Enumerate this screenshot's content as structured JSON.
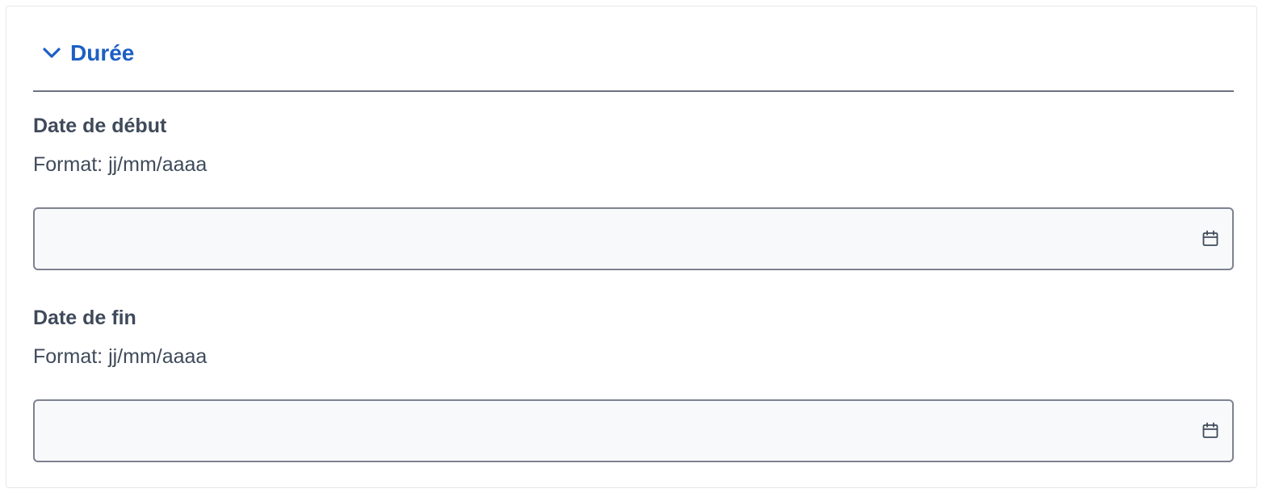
{
  "section": {
    "title": "Durée",
    "expanded": true,
    "toggle_icon": "chevron-down-icon"
  },
  "fields": [
    {
      "label": "Date de début",
      "hint": "Format: jj/mm/aaaa",
      "value": "",
      "icon": "calendar-icon"
    },
    {
      "label": "Date de fin",
      "hint": "Format: jj/mm/aaaa",
      "value": "",
      "icon": "calendar-icon"
    }
  ],
  "colors": {
    "accent": "#1d5fc4",
    "text": "#3f4a5a",
    "input_border": "#7d8290",
    "input_background": "#f8f9fb",
    "divider": "#6b7280"
  }
}
